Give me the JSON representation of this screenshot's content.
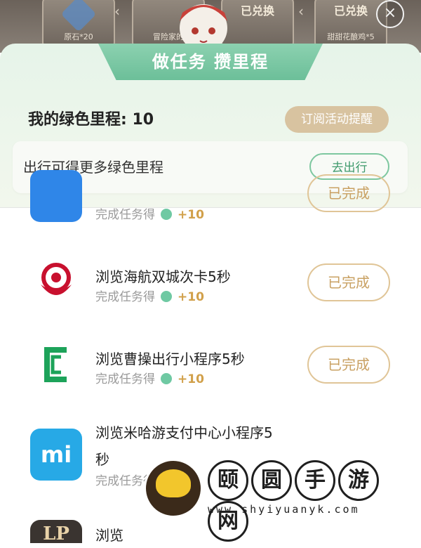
{
  "top_strip": {
    "cards": [
      {
        "caption": "原石*20",
        "status": ""
      },
      {
        "caption": "冒险家的",
        "status": ""
      },
      {
        "caption": "",
        "status": "已兑换"
      },
      {
        "caption": "甜甜花酿鸡*5",
        "status": "已兑换"
      }
    ],
    "close_label": "×"
  },
  "panel": {
    "title": "做任务 攒里程",
    "mileage_text": "我的绿色里程: 10",
    "subscribe_label": "订阅活动提醒",
    "travel_text": "出行可得更多绿色里程",
    "travel_button": "去出行"
  },
  "tasks": [
    {
      "title": "",
      "sub": "完成任务得",
      "reward": "+10",
      "button": "已完成",
      "icon": "blue-app-icon"
    },
    {
      "title": "浏览海航双城次卡5秒",
      "sub": "完成任务得",
      "reward": "+10",
      "button": "已完成",
      "icon": "hainan-airlines-logo-icon"
    },
    {
      "title": "浏览曹操出行小程序5秒",
      "sub": "完成任务得",
      "reward": "+10",
      "button": "已完成",
      "icon": "caocao-logo-icon"
    },
    {
      "title": "浏览米哈游支付中心小程序5",
      "title2": "秒",
      "sub": "完成任务得",
      "icon": "mi-logo-icon"
    },
    {
      "title": "浏览",
      "icon": "lp-logo-icon"
    }
  ],
  "watermark": {
    "chars": [
      "颐",
      "圆",
      "手",
      "游",
      "网"
    ],
    "url": "www.shyiyuanyk.com"
  },
  "colors": {
    "accent_green": "#6cbf99",
    "gold": "#c9a163",
    "reward": "#d1a04a"
  }
}
